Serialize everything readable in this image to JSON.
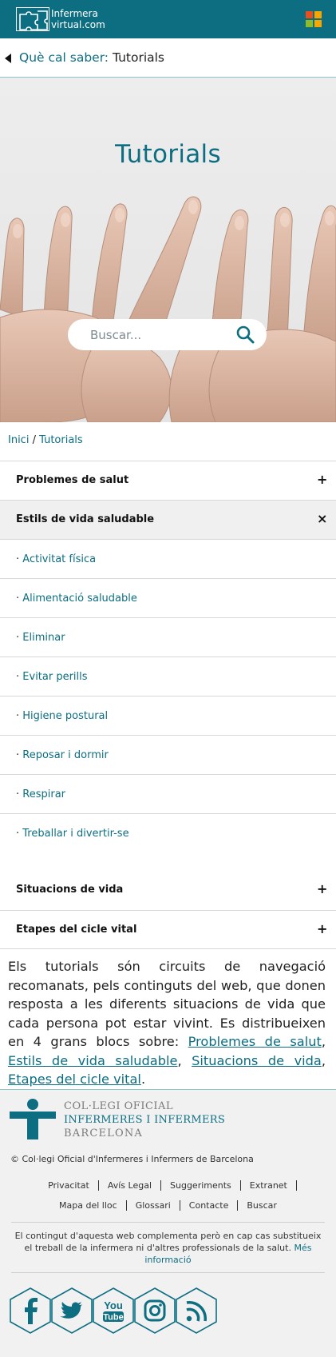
{
  "header": {
    "logo_line1": "Infermera",
    "logo_line2": "virtual.com",
    "apps_colors": [
      "#e94e1b",
      "#f7a600",
      "#8dbb2a",
      "#f7a600"
    ]
  },
  "backnav": {
    "prefix": "Què cal saber:",
    "current": "Tutorials"
  },
  "hero": {
    "title": "Tutorials",
    "search_placeholder": "Buscar..."
  },
  "breadcrumb": {
    "home": "Inici",
    "separator": "/",
    "current": "Tutorials"
  },
  "accordion": [
    {
      "label": "Problemes de salut",
      "sign": "+"
    },
    {
      "label": "Estils de vida saludable",
      "sign": "×"
    },
    {
      "label": "Situacions de vida",
      "sign": "+"
    },
    {
      "label": "Etapes del cicle vital",
      "sign": "+"
    }
  ],
  "sub_items": [
    "Activitat física",
    "Alimentació saludable",
    "Eliminar",
    "Evitar perills",
    "Higiene postural",
    "Reposar i dormir",
    "Respirar",
    "Treballar i divertir-se"
  ],
  "sub_bullet": "·",
  "intro": {
    "text": "Els tutorials són circuits de navegació recomanats, pels continguts del web, que donen resposta a les diferents situacions de vida que cada persona pot estar vivint. Es distribueixen en 4 grans blocs sobre:",
    "links": [
      "Problemes de salut",
      "Estils de vida saludable",
      "Situacions de vida",
      "Etapes del cicle vital"
    ],
    "sep": ",",
    "end": "."
  },
  "footer": {
    "org_line1": "COL·LEGI OFICIAL",
    "org_line2": "INFERMERES I INFERMERS",
    "org_line3": "BARCELONA",
    "copyright": "© Col·legi Oficial d'Infermeres i Infermers de Barcelona",
    "links_row1": [
      "Privacitat",
      "Avís Legal",
      "Suggeriments",
      "Extranet"
    ],
    "links_row2": [
      "Mapa del lloc",
      "Glossari",
      "Contacte",
      "Buscar"
    ],
    "disclaimer": "El contingut d'aquesta web complementa però en cap cas substitueix el treball de la infermera ni d'altres professionals de la salut.",
    "disclaimer_link": "Més informació",
    "social": [
      "facebook-icon",
      "twitter-icon",
      "youtube-icon",
      "instagram-icon",
      "rss-icon"
    ],
    "youtube_top": "You",
    "youtube_bottom": "Tube"
  },
  "colors": {
    "brand": "#0d6e82",
    "footer_bg": "#f1f1f1"
  }
}
